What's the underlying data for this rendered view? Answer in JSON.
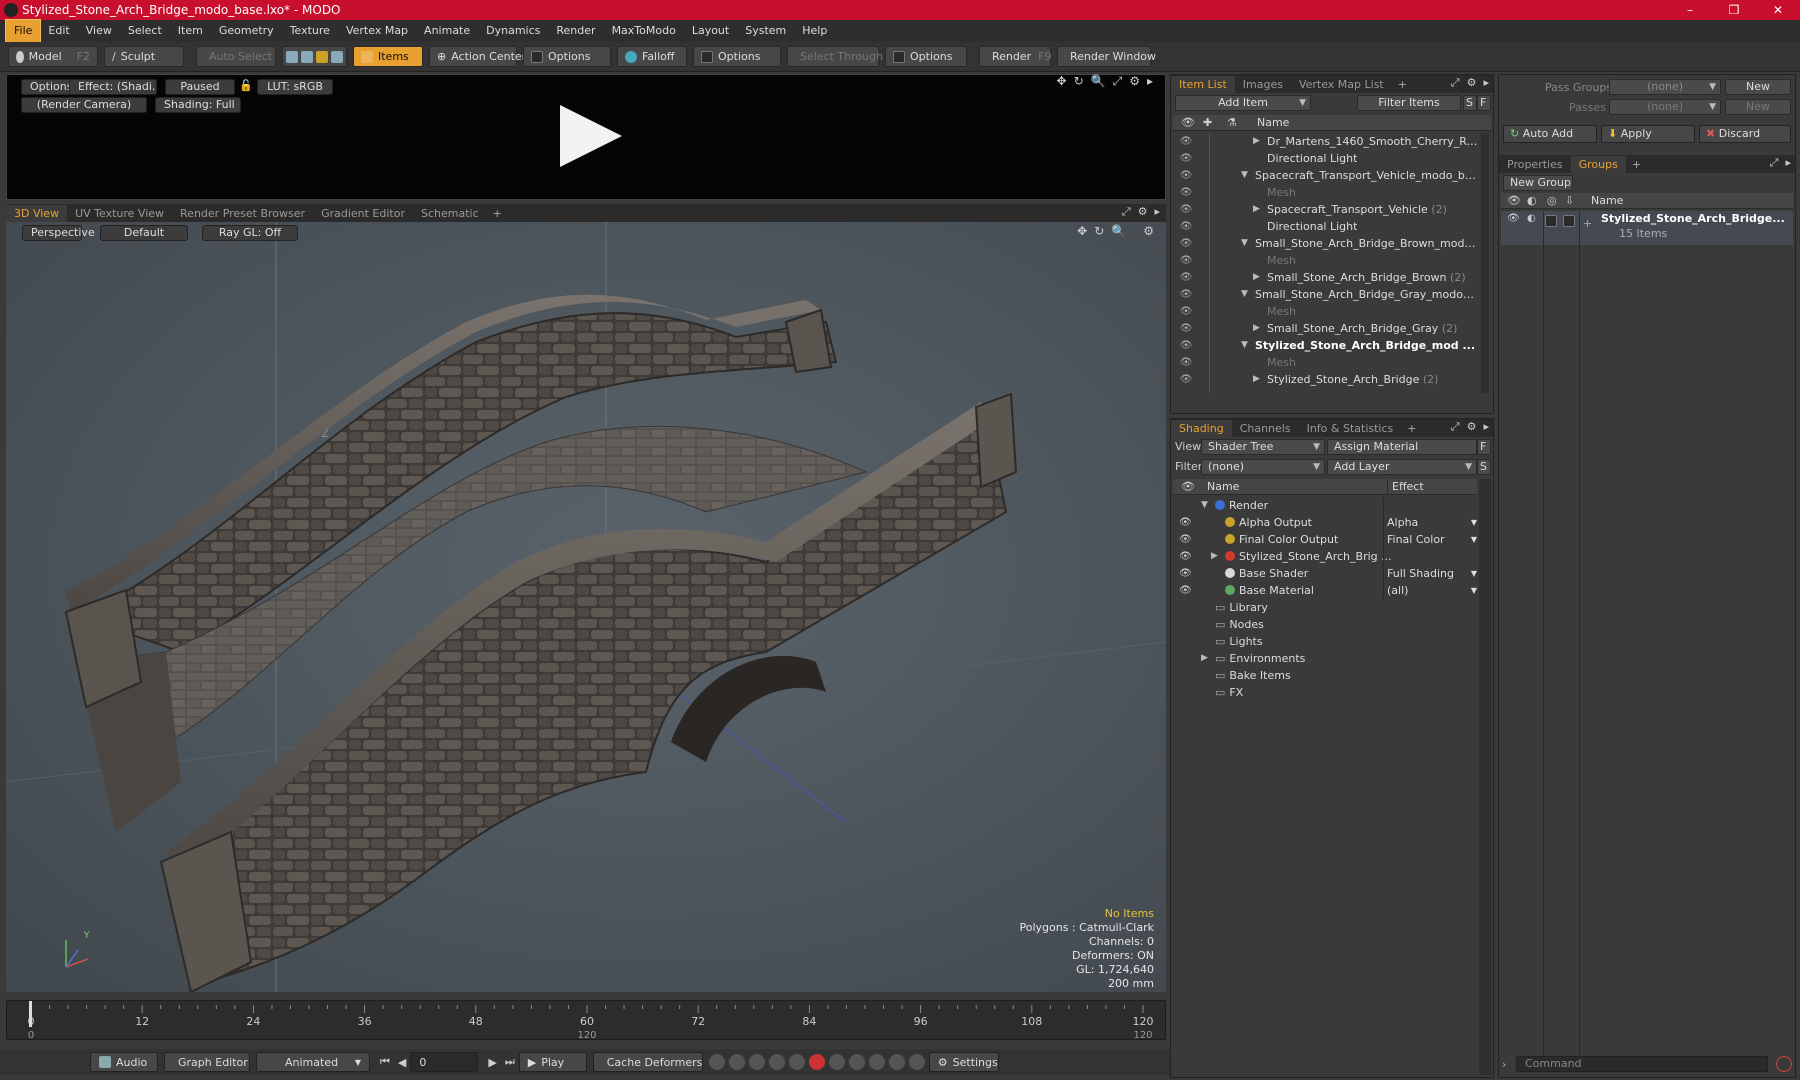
{
  "window": {
    "title": "Stylized_Stone_Arch_Bridge_modo_base.lxo* - MODO",
    "controls": [
      "–",
      "❐",
      "✕"
    ]
  },
  "menu": [
    "File",
    "Edit",
    "View",
    "Select",
    "Item",
    "Geometry",
    "Texture",
    "Vertex Map",
    "Animate",
    "Dynamics",
    "Render",
    "MaxToModo",
    "Layout",
    "System",
    "Help"
  ],
  "toolbar": {
    "model": "Model",
    "model_key": "F2",
    "sculpt": "Sculpt",
    "auto_select": "Auto Select",
    "items": "Items",
    "action_center": "Action Center",
    "options1": "Options",
    "falloff": "Falloff",
    "options2": "Options",
    "select_through": "Select Through",
    "options3": "Options",
    "render": "Render",
    "render_key": "F9",
    "render_window": "Render Window"
  },
  "preview": {
    "options": "Options",
    "effect": "Effect: (Shadi...",
    "paused": "Paused",
    "lut": "LUT: sRGB",
    "camera": "(Render Camera)",
    "shading": "Shading: Full"
  },
  "viewport_tabs": [
    "3D View",
    "UV Texture View",
    "Render Preset Browser",
    "Gradient Editor",
    "Schematic"
  ],
  "viewport": {
    "perspective": "Perspective",
    "default": "Default",
    "raygl": "Ray GL: Off"
  },
  "info": {
    "no_items": "No Items",
    "polygons": "Polygons : Catmull-Clark",
    "channels": "Channels: 0",
    "deformers": "Deformers: ON",
    "gl": "GL: 1,724,640",
    "scale": "200 mm"
  },
  "timeline": {
    "ticks": [
      "0",
      "12",
      "24",
      "36",
      "48",
      "60",
      "72",
      "84",
      "96",
      "108",
      "120"
    ],
    "sub_left": "0",
    "sub_mid": "120",
    "sub_right": "120"
  },
  "bottombar": {
    "audio": "Audio",
    "graph_editor": "Graph Editor",
    "animated": "Animated",
    "frame": "0",
    "play": "Play",
    "cache_deformers": "Cache Deformers",
    "settings": "Settings"
  },
  "item_list": {
    "tabs": [
      "Item List",
      "Images",
      "Vertex Map List"
    ],
    "add_item": "Add Item",
    "filter_items": "Filter Items",
    "s": "S",
    "f": "F",
    "col_name": "Name",
    "rows": [
      {
        "label": "Dr_Martens_1460_Smooth_Cherry_Re...",
        "count": "",
        "indent": 2,
        "arrow": "▶"
      },
      {
        "label": "Directional Light",
        "count": "",
        "indent": 2,
        "arrow": ""
      },
      {
        "label": "Spacecraft_Transport_Vehicle_modo_bas...",
        "count": "",
        "indent": 1,
        "arrow": "▼"
      },
      {
        "label": "Mesh",
        "count": "",
        "indent": 2,
        "arrow": "",
        "dim": true
      },
      {
        "label": "Spacecraft_Transport_Vehicle",
        "count": "(2)",
        "indent": 2,
        "arrow": "▶"
      },
      {
        "label": "Directional Light",
        "count": "",
        "indent": 2,
        "arrow": ""
      },
      {
        "label": "Small_Stone_Arch_Bridge_Brown_modo_...",
        "count": "",
        "indent": 1,
        "arrow": "▼"
      },
      {
        "label": "Mesh",
        "count": "",
        "indent": 2,
        "arrow": "",
        "dim": true
      },
      {
        "label": "Small_Stone_Arch_Bridge_Brown",
        "count": "(2)",
        "indent": 2,
        "arrow": "▶"
      },
      {
        "label": "Small_Stone_Arch_Bridge_Gray_modo_b ...",
        "count": "",
        "indent": 1,
        "arrow": "▼"
      },
      {
        "label": "Mesh",
        "count": "",
        "indent": 2,
        "arrow": "",
        "dim": true
      },
      {
        "label": "Small_Stone_Arch_Bridge_Gray",
        "count": "(2)",
        "indent": 2,
        "arrow": "▶"
      },
      {
        "label": "Stylized_Stone_Arch_Bridge_mod ...",
        "count": "",
        "indent": 1,
        "arrow": "▼",
        "bold": true
      },
      {
        "label": "Mesh",
        "count": "",
        "indent": 2,
        "arrow": "",
        "dim": true
      },
      {
        "label": "Stylized_Stone_Arch_Bridge",
        "count": "(2)",
        "indent": 2,
        "arrow": "▶"
      }
    ]
  },
  "shading": {
    "tabs": [
      "Shading",
      "Channels",
      "Info & Statistics"
    ],
    "view_label": "View",
    "view_value": "Shader Tree",
    "assign_material": "Assign Material",
    "f": "F",
    "filter_label": "Filter",
    "filter_value": "(none)",
    "add_layer": "Add Layer",
    "s": "S",
    "col_name": "Name",
    "col_effect": "Effect",
    "rows": [
      {
        "label": "Render",
        "effect": "",
        "indent": 0,
        "arrow": "▼",
        "color": "#3d6fd8",
        "eye": false
      },
      {
        "label": "Alpha Output",
        "effect": "Alpha",
        "indent": 1,
        "arrow": "",
        "color": "#c9a227",
        "eye": true
      },
      {
        "label": "Final Color Output",
        "effect": "Final Color",
        "indent": 1,
        "arrow": "",
        "color": "#c9a227",
        "eye": true
      },
      {
        "label": "Stylized_Stone_Arch_Brig ...",
        "effect": "",
        "indent": 1,
        "arrow": "▶",
        "color": "#d33a2c",
        "eye": true
      },
      {
        "label": "Base Shader",
        "effect": "Full Shading",
        "indent": 1,
        "arrow": "",
        "color": "#d8d8d8",
        "eye": true
      },
      {
        "label": "Base Material",
        "effect": "(all)",
        "indent": 1,
        "arrow": "",
        "color": "#5fa860",
        "eye": true
      },
      {
        "label": "Library",
        "effect": "",
        "indent": 0,
        "arrow": "",
        "color": "",
        "eye": false
      },
      {
        "label": "Nodes",
        "effect": "",
        "indent": 0,
        "arrow": "",
        "color": "",
        "eye": false
      },
      {
        "label": "Lights",
        "effect": "",
        "indent": 0,
        "arrow": "",
        "color": "",
        "eye": false
      },
      {
        "label": "Environments",
        "effect": "",
        "indent": 0,
        "arrow": "▶",
        "color": "",
        "eye": false
      },
      {
        "label": "Bake Items",
        "effect": "",
        "indent": 0,
        "arrow": "",
        "color": "",
        "eye": false
      },
      {
        "label": "FX",
        "effect": "",
        "indent": 0,
        "arrow": "",
        "color": "",
        "eye": false
      }
    ]
  },
  "right_panel": {
    "pass_groups": "Pass Groups",
    "pass_groups_value": "(none)",
    "new1": "New",
    "passes": "Passes",
    "passes_value": "(none)",
    "new2": "New",
    "auto_add": "Auto Add",
    "apply": "Apply",
    "discard": "Discard",
    "tabs": [
      "Properties",
      "Groups"
    ],
    "new_group": "New Group",
    "col_name": "Name",
    "group_name": "Stylized_Stone_Arch_Bridge...",
    "group_count": "15 Items",
    "command_placeholder": "Command"
  },
  "colors": {
    "accent": "#e8a030",
    "title_bar": "#c8102e"
  }
}
